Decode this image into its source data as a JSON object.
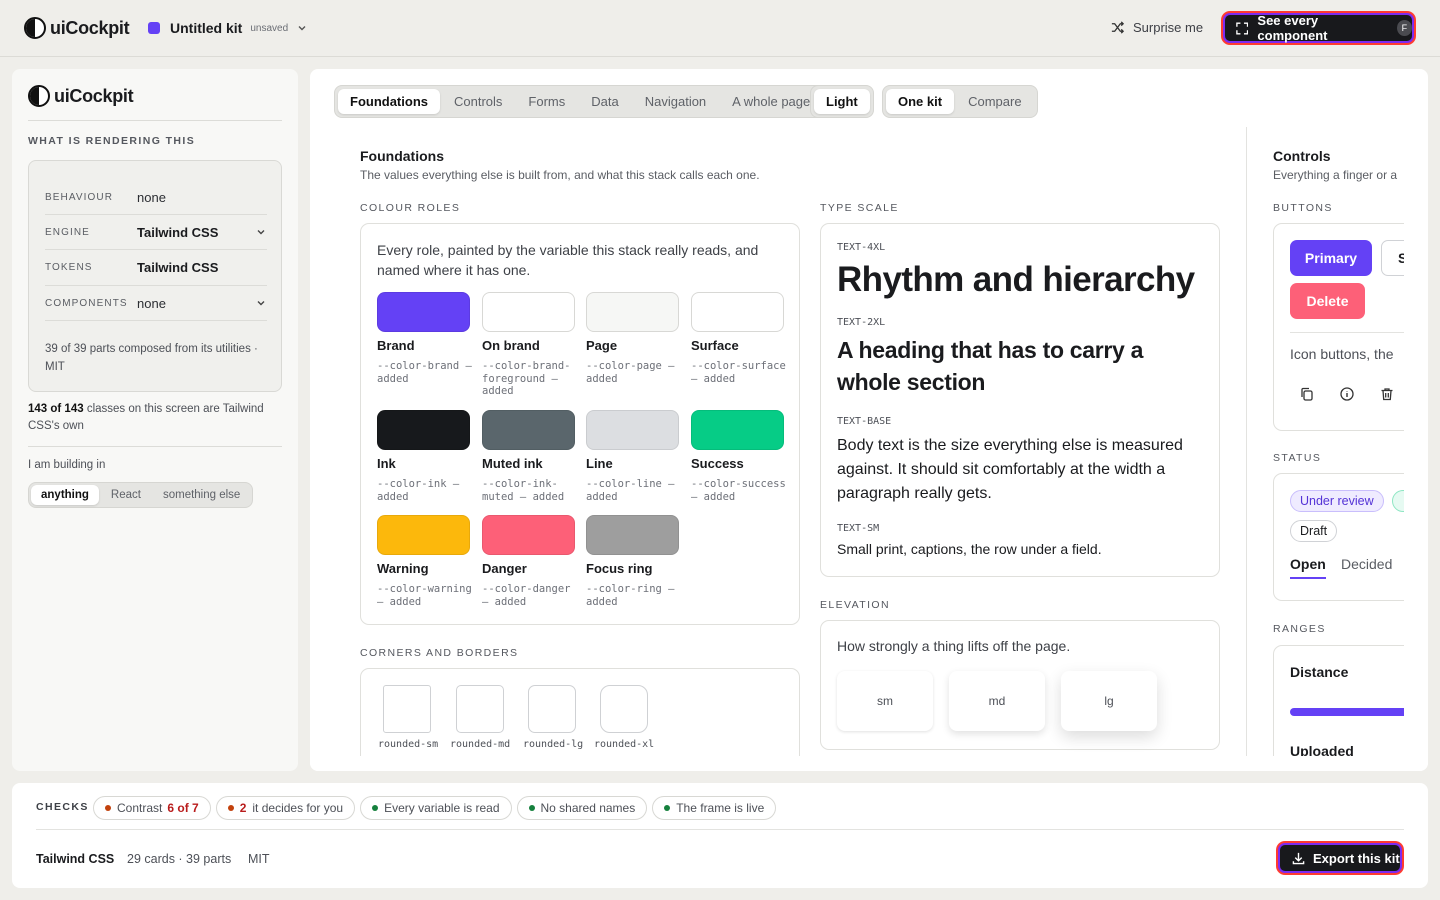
{
  "header": {
    "brand": "uiCockpit",
    "kit_name": "Untitled kit",
    "kit_status": "unsaved",
    "surprise": "Surprise me",
    "see_every": "See every component",
    "see_every_key": "F"
  },
  "sidebar": {
    "brand": "uiCockpit",
    "rendering_heading": "WHAT IS RENDERING THIS",
    "rows": [
      {
        "key": "BEHAVIOUR",
        "value": "none"
      },
      {
        "key": "ENGINE",
        "value": "Tailwind CSS"
      },
      {
        "key": "TOKENS",
        "value": "Tailwind CSS"
      },
      {
        "key": "COMPONENTS",
        "value": "none"
      }
    ],
    "composed_note": "39 of 39 parts composed from its utilities · MIT",
    "classes_count": "143 of 143",
    "classes_rest": " classes on this screen are Tailwind CSS's own",
    "building_label": "I am building in",
    "building_options": [
      "anything",
      "React",
      "something else"
    ],
    "building_selected": "anything"
  },
  "tabs": {
    "sections": [
      "Foundations",
      "Controls",
      "Forms",
      "Data",
      "Navigation",
      "A whole page"
    ],
    "active": "Foundations",
    "theme": "Light",
    "view": [
      "One kit",
      "Compare"
    ],
    "view_active": "One kit"
  },
  "foundations": {
    "title": "Foundations",
    "subtitle": "The values everything else is built from, and what this stack calls each one.",
    "colour_heading": "COLOUR ROLES",
    "colour_intro": "Every role, painted by the variable this stack really reads, and named where it has one.",
    "colours": [
      {
        "name": "Brand",
        "var": "--color-brand — added",
        "hex": "#6441f5"
      },
      {
        "name": "On brand",
        "var": "--color-brand-foreground — added",
        "hex": "#ffffff"
      },
      {
        "name": "Page",
        "var": "--color-page — added",
        "hex": "#f6f7f5"
      },
      {
        "name": "Surface",
        "var": "--color-surface — added",
        "hex": "#ffffff"
      },
      {
        "name": "Ink",
        "var": "--color-ink — added",
        "hex": "#17191c"
      },
      {
        "name": "Muted ink",
        "var": "--color-ink-muted — added",
        "hex": "#5a666c"
      },
      {
        "name": "Line",
        "var": "--color-line — added",
        "hex": "#dcdee1"
      },
      {
        "name": "Success",
        "var": "--color-success — added",
        "hex": "#06cc86"
      },
      {
        "name": "Warning",
        "var": "--color-warning — added",
        "hex": "#fcb80c"
      },
      {
        "name": "Danger",
        "var": "--color-danger — added",
        "hex": "#fd6078"
      },
      {
        "name": "Focus ring",
        "var": "--color-ring — added",
        "hex": "#9e9e9e"
      }
    ],
    "corners_heading": "CORNERS AND BORDERS",
    "corners": [
      "rounded-sm",
      "rounded-md",
      "rounded-lg",
      "rounded-xl"
    ],
    "type_heading": "TYPE SCALE",
    "type": [
      {
        "token": "TEXT-4XL",
        "sample": "Rhythm and hierarchy"
      },
      {
        "token": "TEXT-2XL",
        "sample": "A heading that has to carry a whole section"
      },
      {
        "token": "TEXT-BASE",
        "sample": "Body text is the size everything else is measured against. It should sit comfortably at the width a paragraph really gets."
      },
      {
        "token": "TEXT-SM",
        "sample": "Small print, captions, the row under a field."
      }
    ],
    "elevation_heading": "ELEVATION",
    "elevation_intro": "How strongly a thing lifts off the page.",
    "elevations": [
      "sm",
      "md",
      "lg"
    ]
  },
  "controls": {
    "title": "Controls",
    "subtitle": "Everything a finger or a",
    "buttons_heading": "BUTTONS",
    "primary": "Primary",
    "secondary": "S",
    "delete": "Delete",
    "icon_buttons": "Icon buttons, the",
    "status_heading": "STATUS",
    "badge_review": "Under review",
    "badge_draft": "Draft",
    "tab_open": "Open",
    "tab_decided": "Decided",
    "ranges_heading": "RANGES",
    "distance": "Distance",
    "uploaded": "Uploaded",
    "distance_fill_pct": 100
  },
  "footer": {
    "checks_label": "CHECKS",
    "checks": [
      {
        "label": "Contrast",
        "value": "6 of 7",
        "color": "#c2410c"
      },
      {
        "label": "it decides for you",
        "value": "2",
        "color": "#c2410c"
      },
      {
        "label": "Every variable is read",
        "value": "",
        "color": "#15803d"
      },
      {
        "label": "No shared names",
        "value": "",
        "color": "#15803d"
      },
      {
        "label": "The frame is live",
        "value": "",
        "color": "#15803d"
      }
    ],
    "stack": "Tailwind CSS",
    "counts": "29 cards · 39 parts",
    "license": "MIT",
    "export": "Export this kit"
  }
}
